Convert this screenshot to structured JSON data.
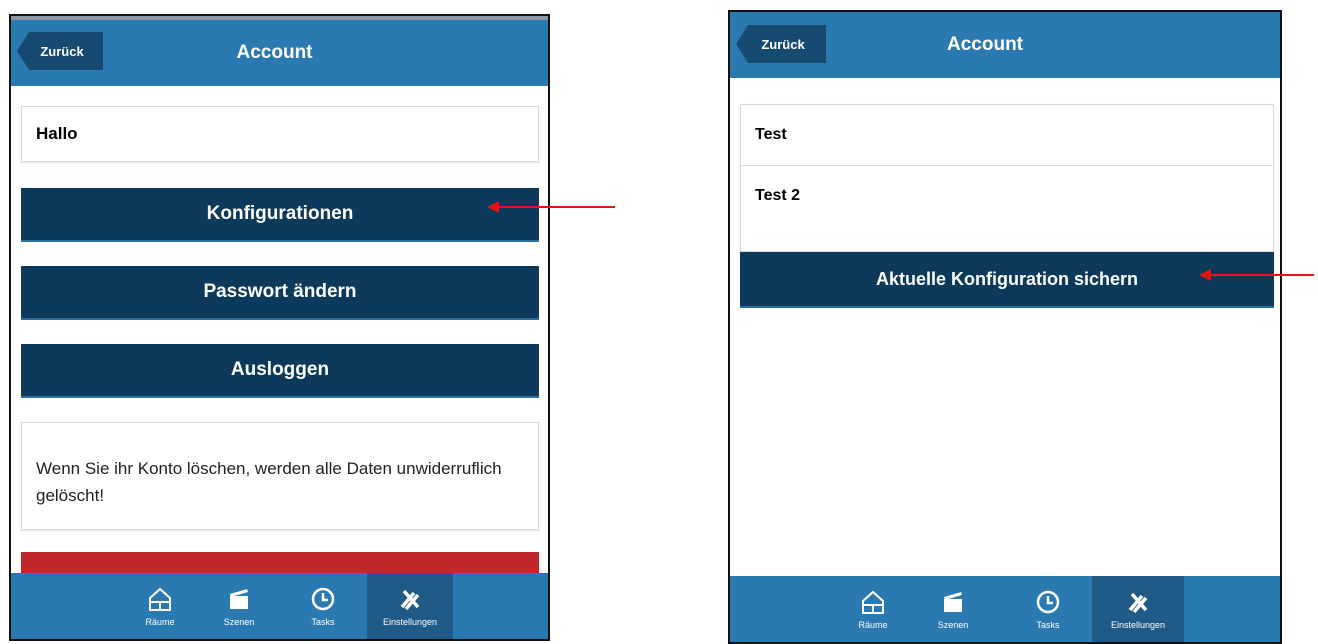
{
  "left": {
    "header": {
      "back_label": "Zurück",
      "title": "Account"
    },
    "greeting": "Hallo",
    "buttons": {
      "configurations": "Konfigurationen",
      "change_password": "Passwort ändern",
      "logout": "Ausloggen"
    },
    "delete_warning": "Wenn Sie ihr Konto löschen, werden alle Daten unwiderruflich gelöscht!",
    "delete_button_color": "#c0282d"
  },
  "right": {
    "header": {
      "back_label": "Zurück",
      "title": "Account"
    },
    "config_items": [
      "Test",
      "Test 2"
    ],
    "save_button": "Aktuelle Konfiguration sichern"
  },
  "tabbar": {
    "items": [
      {
        "label": "Räume",
        "icon": "house-icon"
      },
      {
        "label": "Szenen",
        "icon": "clapperboard-icon"
      },
      {
        "label": "Tasks",
        "icon": "clock-icon"
      },
      {
        "label": "Einstellungen",
        "icon": "tools-icon"
      }
    ],
    "active": "Einstellungen"
  },
  "colors": {
    "header": "#2a7ab1",
    "button": "#0d3a5a",
    "back_button": "#174a70",
    "annotation_arrow": "#e01616"
  }
}
